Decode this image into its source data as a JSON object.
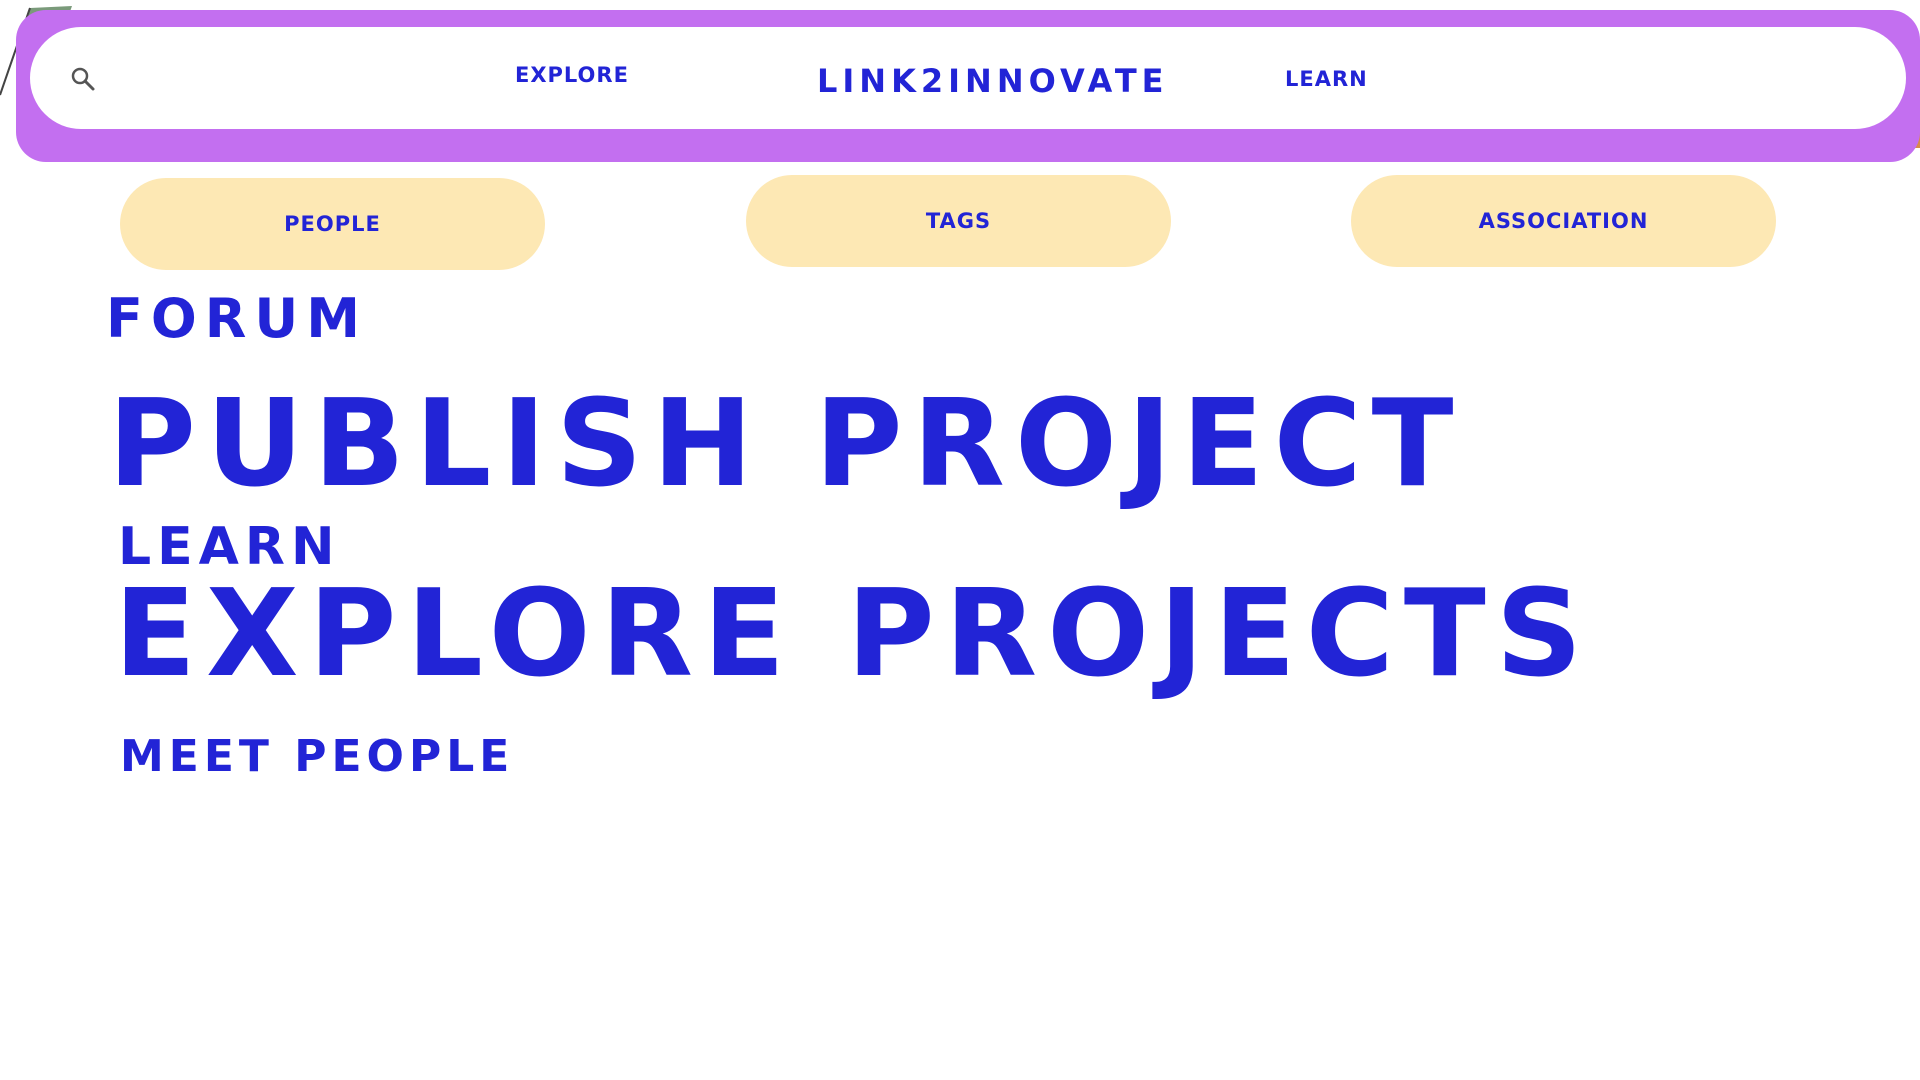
{
  "header": {
    "explore_label": "EXPLORE",
    "brand": "LINK2INNOVATE",
    "learn_label": "LEARN",
    "search_icon": "search-icon"
  },
  "categories": [
    {
      "label": "PEOPLE"
    },
    {
      "label": "TAGS"
    },
    {
      "label": "ASSOCIATION"
    }
  ],
  "main": {
    "forum": "FORUM",
    "publish_project": "PUBLISH PROJECT",
    "learn": "LEARN",
    "explore_projects": "EXPLORE PROJECTS",
    "meet_people": "MEET PEOPLE"
  },
  "colors": {
    "text": "#2224d6",
    "nav_frame": "#c36ff0",
    "pill": "#fde8b4",
    "background": "#ffffff"
  }
}
